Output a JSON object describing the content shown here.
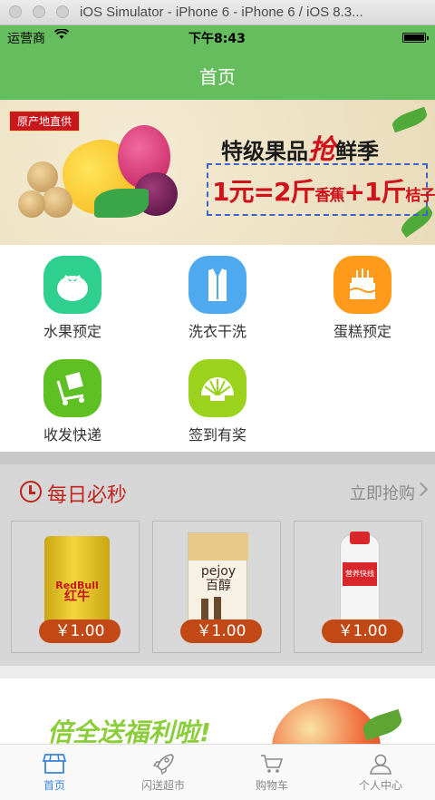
{
  "window": {
    "title": "iOS Simulator - iPhone 6 - iPhone 6 / iOS 8.3..."
  },
  "status_bar": {
    "carrier": "运营商",
    "time": "下午8:43"
  },
  "nav": {
    "title": "首页"
  },
  "banner": {
    "badge": "原产地直供",
    "headline_a": "特级果品",
    "headline_em": "抢",
    "headline_b": "鲜季",
    "offer_a": "1元=2斤",
    "offer_small_a": "香蕉",
    "offer_plus": "+1斤",
    "offer_small_b": "桔子"
  },
  "services": [
    {
      "label": "水果预定",
      "icon": "tomato-icon",
      "color": "#2fcf8f"
    },
    {
      "label": "洗衣干洗",
      "icon": "shirt-icon",
      "color": "#4fa9ee"
    },
    {
      "label": "蛋糕预定",
      "icon": "cake-icon",
      "color": "#ff9a1a"
    },
    {
      "label": "收发快递",
      "icon": "delivery-cart-icon",
      "color": "#5ec024"
    },
    {
      "label": "签到有奖",
      "icon": "shell-icon",
      "color": "#9bd21d"
    }
  ],
  "flash_sale": {
    "title": "每日必秒",
    "more": "立即抢购",
    "products": [
      {
        "name": "RedBull 红牛",
        "brand_line1": "RedBull",
        "brand_line2": "红牛",
        "price": "￥1.00"
      },
      {
        "name": "pejoy 百醇",
        "brand_line1": "pejoy",
        "brand_line2": "百醇",
        "price": "￥1.00"
      },
      {
        "name": "营养快线",
        "brand_line1": "营养快线",
        "price": "￥1.00"
      }
    ]
  },
  "promo": {
    "text": "倍全送福利啦!"
  },
  "tabs": [
    {
      "label": "首页",
      "icon": "store-icon",
      "active": true
    },
    {
      "label": "闪送超市",
      "icon": "rocket-icon",
      "active": false
    },
    {
      "label": "购物车",
      "icon": "cart-icon",
      "active": false
    },
    {
      "label": "个人中心",
      "icon": "person-icon",
      "active": false
    }
  ],
  "colors": {
    "brand_green": "#66bd5e",
    "sale_red": "#c0231c",
    "price_orange": "#c24815",
    "tab_active": "#3a84d9"
  }
}
